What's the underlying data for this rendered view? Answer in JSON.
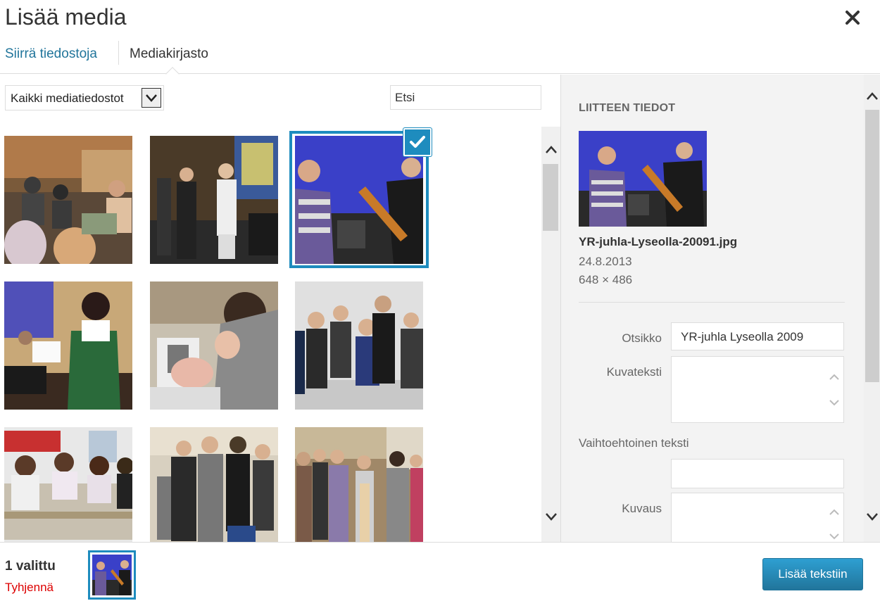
{
  "modal": {
    "title": "Lisää media",
    "close_icon": "close-icon"
  },
  "router": {
    "tabs": [
      {
        "label": "Siirrä tiedostoja",
        "active": false
      },
      {
        "label": "Mediakirjasto",
        "active": true
      }
    ]
  },
  "toolbar": {
    "filter_value": "Kaikki mediatiedostot",
    "search_placeholder": "Etsi"
  },
  "grid": {
    "items": [
      {
        "name": "audience-hall-photo"
      },
      {
        "name": "singers-stage-photo"
      },
      {
        "name": "guitar-players-photo",
        "selected": true
      },
      {
        "name": "singer-reading-photo"
      },
      {
        "name": "student-microscope-photo"
      },
      {
        "name": "group-boys-photo"
      },
      {
        "name": "classroom-girls-photo"
      },
      {
        "name": "group-students-photo"
      },
      {
        "name": "group-hallway-photo"
      }
    ]
  },
  "details": {
    "heading": "LIITTEEN TIEDOT",
    "filename": "YR-juhla-Lyseolla-20091.jpg",
    "date": "24.8.2013",
    "dimensions": "648 × 486",
    "fields": {
      "title_label": "Otsikko",
      "title_value": "YR-juhla Lyseolla 2009",
      "caption_label": "Kuvateksti",
      "alt_label": "Vaihtoehtoinen teksti",
      "description_label": "Kuvaus"
    }
  },
  "footer": {
    "selected_count": "1 valittu",
    "clear_label": "Tyhjennä",
    "insert_label": "Lisää tekstiin"
  },
  "colors": {
    "accent": "#1e8cbe",
    "link": "#21759b",
    "danger": "#dd0000"
  }
}
